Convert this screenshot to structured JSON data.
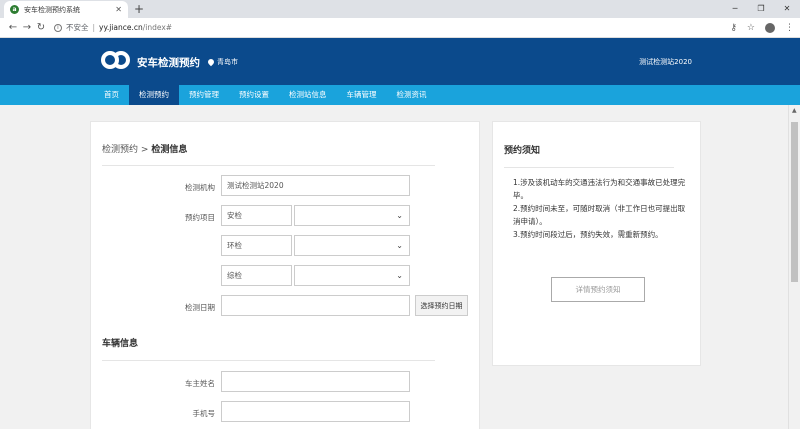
{
  "browser": {
    "tab_title": "安车检测预约系统",
    "new_tab": "+",
    "insecure_label": "不安全",
    "url_host": "yy.jiance.cn",
    "url_path": "/index#"
  },
  "header": {
    "site_title": "安车检测预约",
    "city": "青岛市",
    "station": "测试检测站2020"
  },
  "nav": {
    "items": [
      "首页",
      "检测预约",
      "预约管理",
      "预约设置",
      "检测站信息",
      "车辆管理",
      "检测资讯"
    ],
    "active_index": 1
  },
  "breadcrumb": {
    "parent": "检测预约",
    "separator": ">",
    "current": "检测信息"
  },
  "form": {
    "institution_label": "检测机构",
    "institution_value": "测试检测站2020",
    "project_label": "预约项目",
    "projects": [
      "安检",
      "环检",
      "综检"
    ],
    "date_label": "检测日期",
    "date_button": "选择预约日期"
  },
  "vehicle": {
    "section_title": "车辆信息",
    "owner_label": "车主姓名",
    "phone_label": "手机号"
  },
  "notice": {
    "title": "预约须知",
    "items": [
      "1.涉及该机动车的交通违法行为和交通事故已处理完毕。",
      "2.预约时间未至，可随时取消（非工作日也可提出取消申请）。",
      "3.预约时间段过后，预约失效，需重新预约。"
    ],
    "detail_button": "详情预约须知"
  },
  "colors": {
    "header_bg": "#0b4a8c",
    "nav_bg": "#1aa3dc",
    "nav_active": "#0b4a8c"
  }
}
